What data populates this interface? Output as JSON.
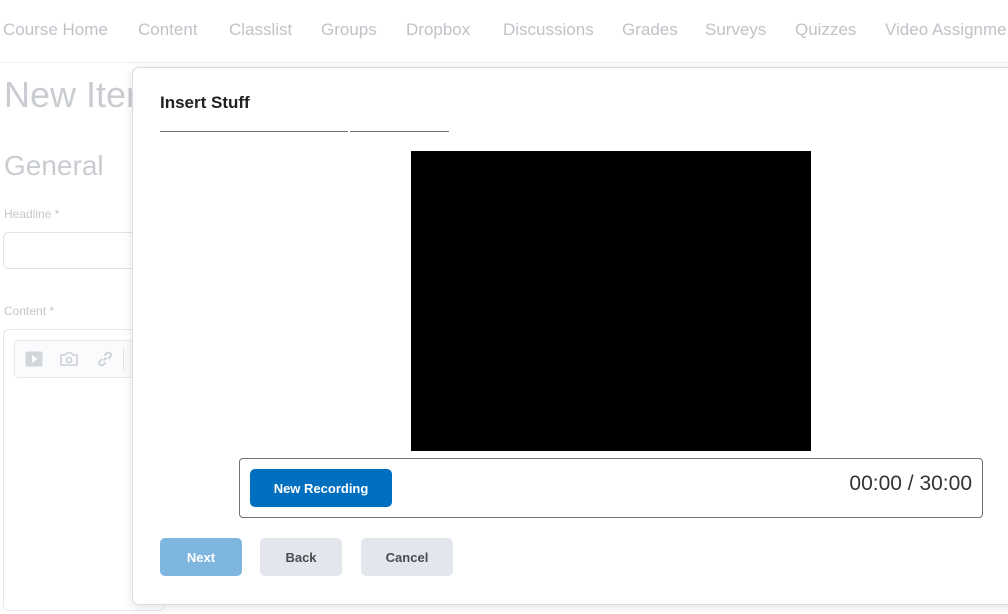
{
  "nav": {
    "items": [
      "Course Home",
      "Content",
      "Classlist",
      "Groups",
      "Dropbox",
      "Discussions",
      "Grades",
      "Surveys",
      "Quizzes",
      "Video Assignme"
    ]
  },
  "page": {
    "title": "New Iter",
    "section": "General",
    "headline_label": "Headline *",
    "content_label": "Content *"
  },
  "modal": {
    "title": "Insert Stuff",
    "recorder": {
      "record_label": "New Recording",
      "timer": "00:00 / 30:00"
    },
    "footer": {
      "next_label": "Next",
      "back_label": "Back",
      "cancel_label": "Cancel"
    }
  },
  "colors": {
    "primary": "#006fbf",
    "primary_disabled": "#7fb6df",
    "secondary_bg": "#e3e7ed"
  }
}
